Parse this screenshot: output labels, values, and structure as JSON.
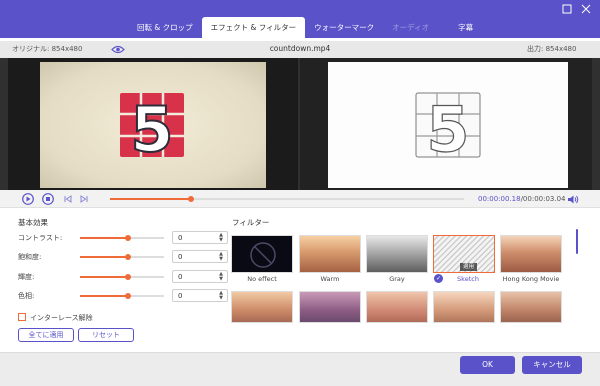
{
  "tabs": [
    {
      "label": "回転 & クロップ"
    },
    {
      "label": "エフェクト & フィルター"
    },
    {
      "label": "ウォーターマーク"
    },
    {
      "label": "オーディオ"
    },
    {
      "label": "字幕"
    }
  ],
  "info": {
    "original": "オリジナル: 854x480",
    "filename": "countdown.mp4",
    "output": "出力: 854x480"
  },
  "preview": {
    "digit": "5"
  },
  "player": {
    "progress": 0.23,
    "current_time": "00:00:00.18",
    "total_time": "/00:00:03.04"
  },
  "basic": {
    "title": "基本効果",
    "rows": [
      {
        "label": "コントラスト:",
        "value": "0",
        "level": 0.5
      },
      {
        "label": "飽和度:",
        "value": "0",
        "level": 0.5
      },
      {
        "label": "輝度:",
        "value": "0",
        "level": 0.5
      },
      {
        "label": "色相:",
        "value": "0",
        "level": 0.5
      }
    ],
    "deinterlace": "インターレース解除",
    "apply_all": "全てに適用",
    "reset": "リセット"
  },
  "filters": {
    "title": "フィルター",
    "items": [
      {
        "label": "No effect"
      },
      {
        "label": "Warm"
      },
      {
        "label": "Gray"
      },
      {
        "label": "Sketch"
      },
      {
        "label": "Hong Kong Movie"
      }
    ],
    "badge": "適用"
  },
  "footer": {
    "ok": "OK",
    "cancel": "キャンセル"
  },
  "colors": {
    "accent": "#5a52c9",
    "orange": "#f06b3a"
  }
}
